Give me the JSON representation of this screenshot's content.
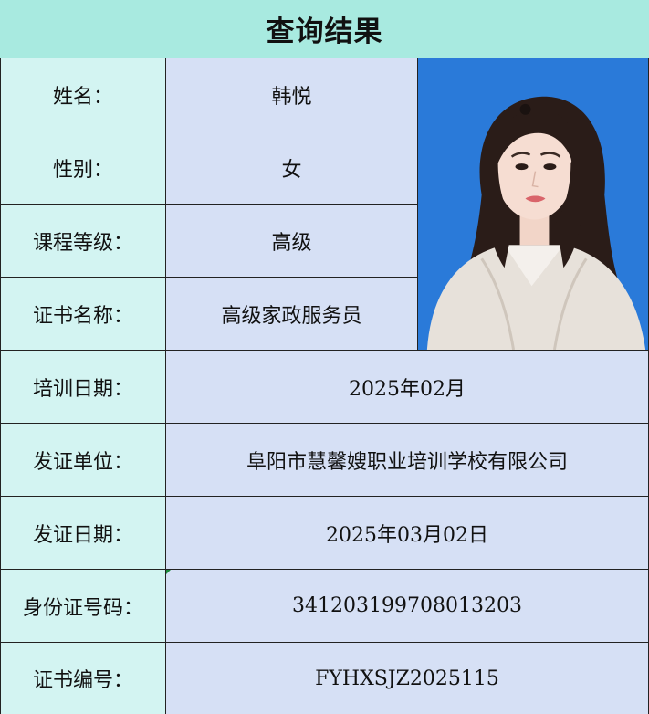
{
  "title": "查询结果",
  "fields": {
    "name": {
      "label": "姓名：",
      "value": "韩悦"
    },
    "gender": {
      "label": "性别：",
      "value": "女"
    },
    "course_level": {
      "label": "课程等级：",
      "value": "高级"
    },
    "certificate_name": {
      "label": "证书名称：",
      "value": "高级家政服务员"
    },
    "training_date": {
      "label": "培训日期：",
      "value": "2025年02月"
    },
    "issuer": {
      "label": "发证单位：",
      "value": "阜阳市慧馨嫂职业培训学校有限公司"
    },
    "issue_date": {
      "label": "发证日期：",
      "value": "2025年03月02日"
    },
    "id_number": {
      "label": "身份证号码：",
      "value": "341203199708013203"
    },
    "certificate_number": {
      "label": "证书编号：",
      "value": "FYHXSJZ2025115"
    }
  },
  "colors": {
    "title_bg": "#a8eae0",
    "label_bg": "#d3f4f2",
    "value_bg": "#d6e0f5",
    "photo_bg": "#2a7ad9",
    "border": "#222222"
  },
  "photo": {
    "icon": "portrait-photo"
  }
}
